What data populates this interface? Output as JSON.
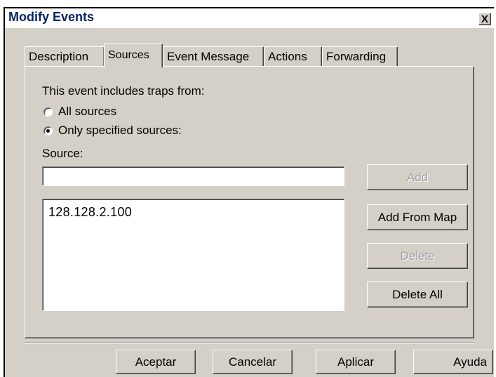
{
  "window": {
    "title": "Modify Events",
    "close_glyph": "X"
  },
  "tabs": [
    {
      "label": "Description"
    },
    {
      "label": "Sources",
      "active": true
    },
    {
      "label": "Event Message"
    },
    {
      "label": "Actions"
    },
    {
      "label": "Forwarding"
    }
  ],
  "sources_panel": {
    "heading": "This event includes traps from:",
    "options": [
      {
        "label": "All sources",
        "checked": false
      },
      {
        "label": "Only specified sources:",
        "checked": true
      }
    ],
    "source_label": "Source:",
    "source_value": "",
    "source_list": [
      "128.128.2.100"
    ],
    "buttons": {
      "add": "Add",
      "add_from_map": "Add From Map",
      "delete": "Delete",
      "delete_all": "Delete All"
    }
  },
  "footer_buttons": {
    "ok": "Aceptar",
    "cancel": "Cancelar",
    "apply": "Aplicar",
    "help": "Ayuda"
  }
}
